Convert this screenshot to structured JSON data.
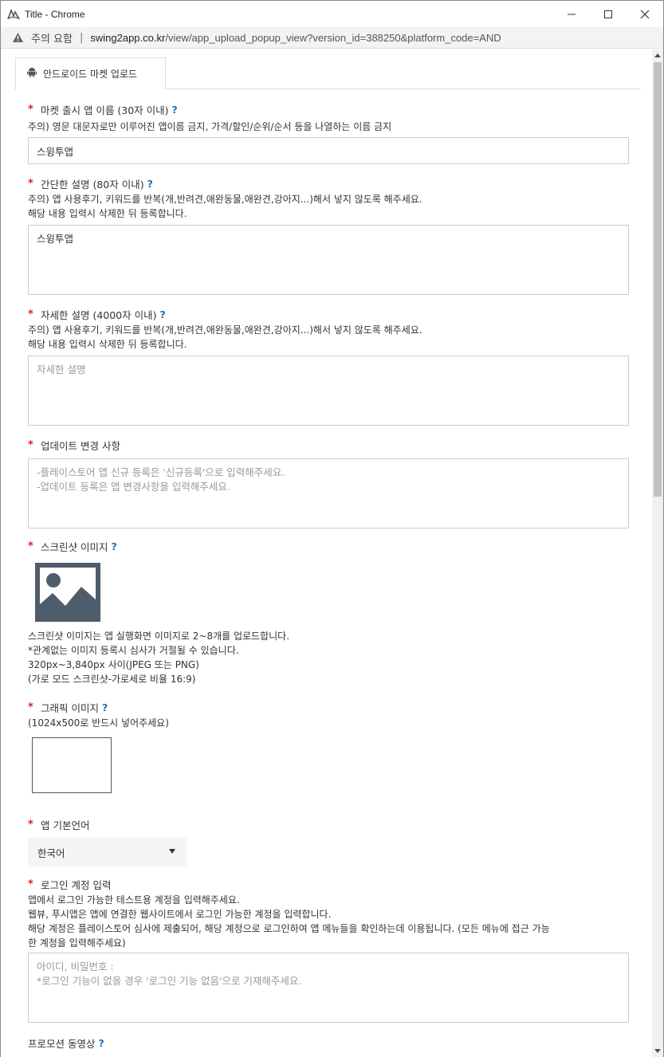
{
  "window": {
    "title": "Title - Chrome"
  },
  "address_bar": {
    "security_text": "주의 요함",
    "separator": "|",
    "url_host": "swing2app.co.kr",
    "url_path": "/view/app_upload_popup_view?version_id=388250&platform_code=AND"
  },
  "tabs": [
    {
      "label": "안드로이드 마켓 업로드",
      "icon": "android-icon"
    }
  ],
  "form": {
    "app_name": {
      "label": "마켓 출시 앱 이름 (30자 이내)",
      "help": "?",
      "note": "주의) 영문 대문자로만 이루어진 앱이름 금지, 가격/할인/순위/순서 등을 나열하는 이름 금지",
      "value": "스윙투앱"
    },
    "short_desc": {
      "label": "간단한 설명 (80자 이내)",
      "help": "?",
      "note1": "주의) 앱 사용후기, 키워드를 반복(개,반려견,애완동물,애완견,강아지...)해서 넣지 않도록 해주세요.",
      "note2": "해당 내용 입력시 삭제한 뒤 등록합니다.",
      "value": "스윙투앱"
    },
    "long_desc": {
      "label": "자세한 설명 (4000자 이내)",
      "help": "?",
      "note1": "주의) 앱 사용후기, 키워드를 반복(개,반려견,애완동물,애완견,강아지...)해서 넣지 않도록 해주세요.",
      "note2": "해당 내용 입력시 삭제한 뒤 등록합니다.",
      "placeholder": "자세한 설명"
    },
    "update_notes": {
      "label": "업데이트 변경 사항",
      "placeholder1": "-플레이스토어 앱 신규 등록은 '신규등록'으로 입력해주세요.",
      "placeholder2": "-업데이트 등록은 앱 변경사항을 입력해주세요."
    },
    "screenshots": {
      "label": "스크린샷 이미지",
      "help": "?",
      "note1": "스크린샷 이미지는 앱 실행화면 이미지로 2~8개를 업로드합니다.",
      "note2": "*관계없는 이미지 등록시 심사가 거절될 수 있습니다.",
      "note3": "320px~3,840px 사이(JPEG 또는 PNG)",
      "note4": "(가로 모드 스크린샷-가로세로 비율 16:9)"
    },
    "graphic": {
      "label": "그래픽 이미지",
      "help": "?",
      "note": "(1024x500로 반드시 넣어주세요)"
    },
    "language": {
      "label": "앱 기본언어",
      "selected": "한국어"
    },
    "login": {
      "label": "로그인 계정 입력",
      "note1": "앱에서 로그인 가능한 테스트용 계정을 입력해주세요.",
      "note2": "웹뷰, 푸시앱은 앱에 연결한 웹사이트에서 로그인 가능한 계정을 입력합니다.",
      "note3": "해당 계정은 플레이스토어 심사에 제출되어, 해당 계정으로 로그인하여 앱 메뉴들을 확인하는데 이용됩니다. (모든 메뉴에 접근 가능",
      "note4": "한 계정을 입력해주세요)",
      "placeholder1": "아이디, 비밀번호 :",
      "placeholder2": "*로그인 기능이 없을 경우 '로그인 기능 없음'으로 기재해주세요."
    },
    "promo_video": {
      "label": "프로모션 동영상",
      "help": "?"
    }
  },
  "colors": {
    "required": "#e02020",
    "help": "#1e6fb8",
    "image_icon": "#4e5d6c"
  }
}
